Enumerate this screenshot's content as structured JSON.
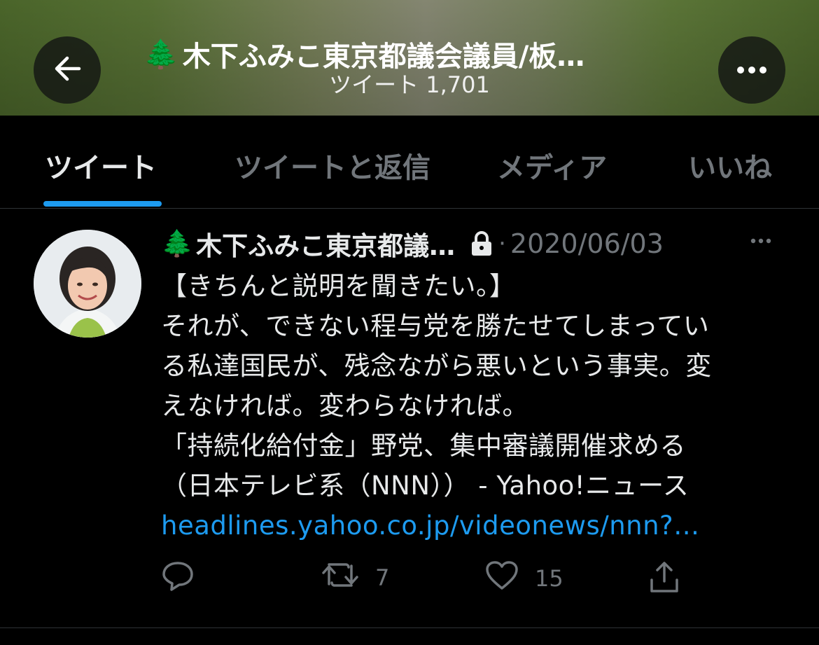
{
  "header": {
    "emoji": "🌲",
    "title": "木下ふみこ東京都議会議員/板…",
    "subtitle": "ツイート 1,701"
  },
  "tabs": [
    {
      "label": "ツイート",
      "active": true
    },
    {
      "label": "ツイートと返信",
      "active": false
    },
    {
      "label": "メディア",
      "active": false
    },
    {
      "label": "いいね",
      "active": false
    }
  ],
  "tweet": {
    "emoji": "🌲",
    "author": "木下ふみこ東京都議…",
    "separator": "·",
    "date": "2020/06/03",
    "lines": [
      "【きちんと説明を聞きたい。】",
      "それが、できない程与党を勝たせてしまってい",
      "る私達国民が、残念ながら悪いという事実。変",
      "えなければ。変わらなければ。",
      "「持続化給付金」野党、集中審議開催求める",
      "（日本テレビ系（NNN）） - Yahoo!ニュース"
    ],
    "link": "headlines.yahoo.co.jp/videonews/nnn?…",
    "reply_count": "",
    "retweet_count": "7",
    "like_count": "15"
  },
  "colors": {
    "background": "#000000",
    "accent": "#1d9bf0",
    "muted": "#71767b",
    "text": "#e7e9ea"
  },
  "icons": [
    "back-arrow-icon",
    "more-horizontal-icon",
    "lock-icon",
    "reply-icon",
    "retweet-icon",
    "like-icon",
    "share-icon"
  ]
}
